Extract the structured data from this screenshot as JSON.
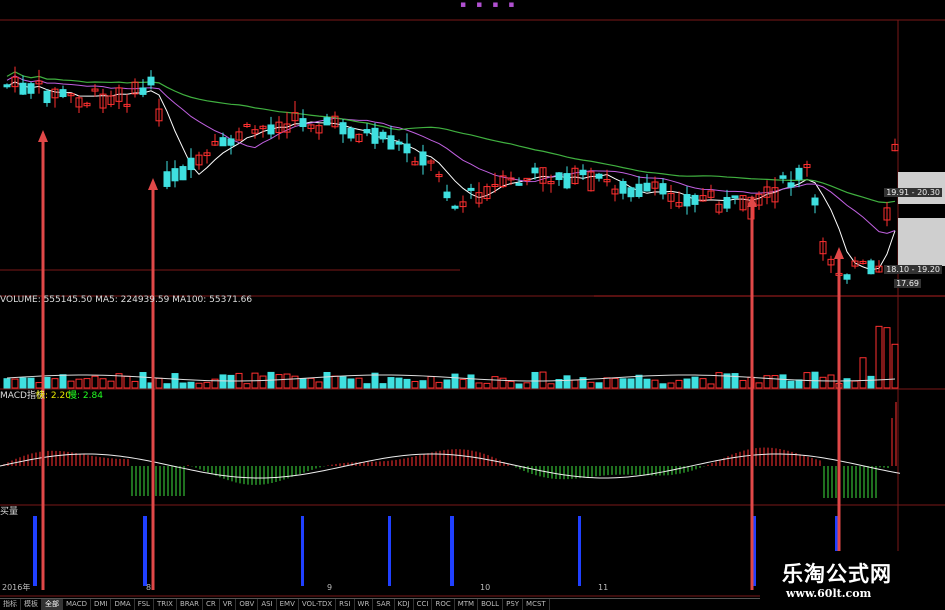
{
  "header": {
    "info_text": "",
    "marks": "▪▪▪▪"
  },
  "volume": {
    "label": "VOLUME: 555145.50 MA5: 224939.59 MA100: 55371.66"
  },
  "macd": {
    "title": "MACD指标",
    "val1": "快: 2.20",
    "val2": "慢: 2.84"
  },
  "signal": {
    "title": "买量"
  },
  "price_tags": {
    "upper": "19.91 - 20.30",
    "lower": "18.10 - 19.20",
    "low": "17.69"
  },
  "bottom_dates": [
    "2016年",
    "8",
    "9",
    "10",
    "11"
  ],
  "tabs": [
    "指标",
    "模板",
    "全部",
    "MACD",
    "DMI",
    "DMA",
    "FSL",
    "TRIX",
    "BRAR",
    "CR",
    "VR",
    "OBV",
    "ASI",
    "EMV",
    "VOL-TDX",
    "RSI",
    "WR",
    "SAR",
    "KDJ",
    "CCI",
    "ROC",
    "MTM",
    "BOLL",
    "PSY",
    "MCST"
  ],
  "active_tab": "全部",
  "logo": {
    "name": "乐淘公式网",
    "url": "www.60lt.com"
  },
  "colors": {
    "up": "#ff3030",
    "down": "#3fe0e0",
    "ma_short": "#ffffff",
    "ma_mid": "#c060e0",
    "ma_long": "#40b040",
    "arrow": "#e04848",
    "signal_bar": "#2040ff"
  }
}
